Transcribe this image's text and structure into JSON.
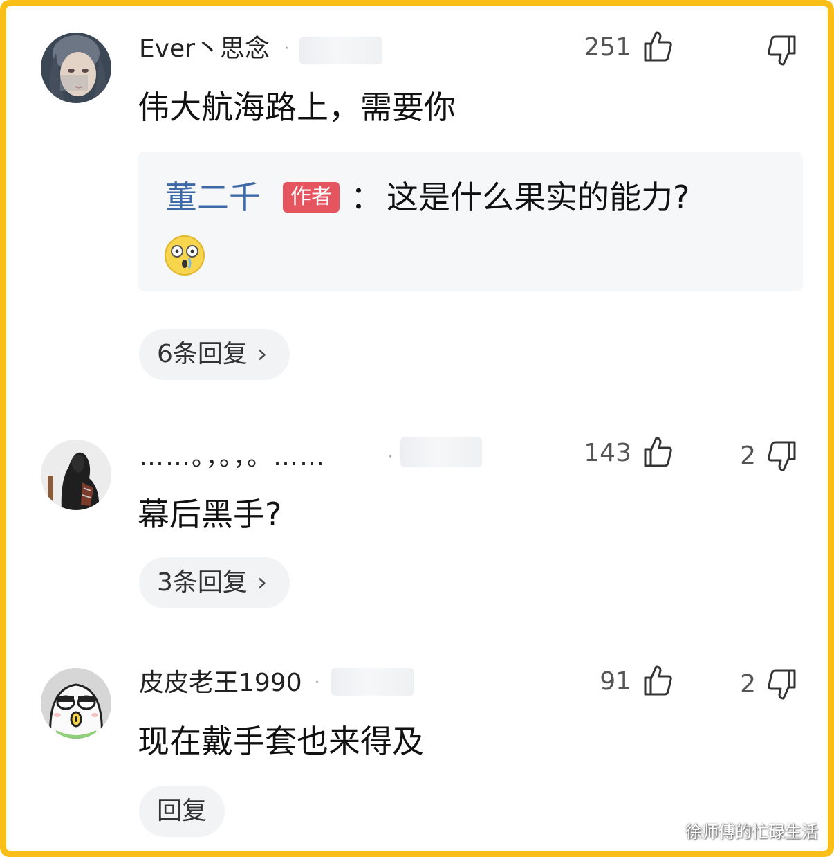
{
  "comments": [
    {
      "username": "Ever丶思念",
      "likes": "251",
      "dislikes": "",
      "content": "伟大航海路上，需要你",
      "author_reply": {
        "author": "董二千",
        "badge": "作者",
        "colon": "：",
        "text": "这是什么果实的能力?"
      },
      "replies_label": "6条回复",
      "avatar_icon": "girl-portrait-avatar"
    },
    {
      "username": "……。，。，。……",
      "likes": "143",
      "dislikes": "2",
      "content": "幕后黑手?",
      "replies_label": "3条回复",
      "avatar_icon": "hooded-figure-avatar"
    },
    {
      "username": "皮皮老王1990",
      "likes": "91",
      "dislikes": "2",
      "content": "现在戴手套也来得及",
      "replies_label": "回复",
      "avatar_icon": "cartoon-egg-avatar"
    }
  ],
  "separator_dot": "·",
  "chevron": "›",
  "watermark": "徐师傅的忙碌生活",
  "colors": {
    "frame": "#f9be18",
    "author_name": "#3d6aa6",
    "author_badge": "#e5555f",
    "pill_bg": "#f2f3f5"
  }
}
